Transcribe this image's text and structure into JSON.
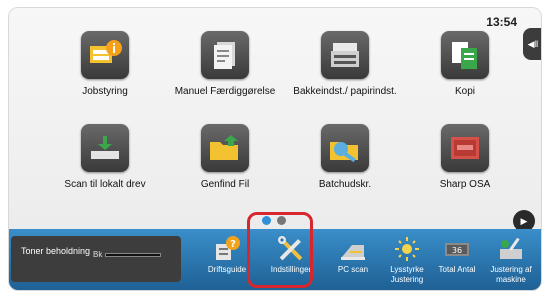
{
  "status": {
    "clock": "13:54"
  },
  "side_tab": {
    "icon": "chevron-left-icon",
    "glyph": "◀‖"
  },
  "tiles": [
    {
      "label": "Jobstyring",
      "icon": "job-status-icon"
    },
    {
      "label": "Manuel Færdiggørelse",
      "icon": "manual-finishing-icon"
    },
    {
      "label": "Bakkeindst./ papirindst.",
      "icon": "tray-settings-icon"
    },
    {
      "label": "Kopi",
      "icon": "copy-icon"
    },
    {
      "label": "Scan til lokalt drev",
      "icon": "scan-to-local-drive-icon"
    },
    {
      "label": "Genfind Fil",
      "icon": "retrieve-file-icon"
    },
    {
      "label": "Batchudskr.",
      "icon": "batch-print-icon"
    },
    {
      "label": "Sharp OSA",
      "icon": "sharp-osa-icon"
    }
  ],
  "pager": {
    "pages": 2,
    "current": 1
  },
  "next_button": {
    "glyph": "▶"
  },
  "toner": {
    "label": "Toner beholdning",
    "channel": "Bk",
    "level": 1.0
  },
  "bottom_bar": [
    {
      "label": "Driftsguide",
      "icon": "operation-guide-icon"
    },
    {
      "label": "Indstillinger",
      "icon": "settings-tools-icon"
    },
    {
      "label": "PC scan",
      "icon": "pc-scan-icon"
    },
    {
      "label": "Lysstyrke Justering",
      "icon": "brightness-icon"
    },
    {
      "label": "Total Antal",
      "icon": "total-count-icon"
    },
    {
      "label": "Justering af maskine",
      "icon": "machine-adjustment-icon"
    }
  ],
  "colors": {
    "bar": "#1d5f93",
    "highlight": "#d8262e",
    "active_dot": "#2f8fd8"
  }
}
